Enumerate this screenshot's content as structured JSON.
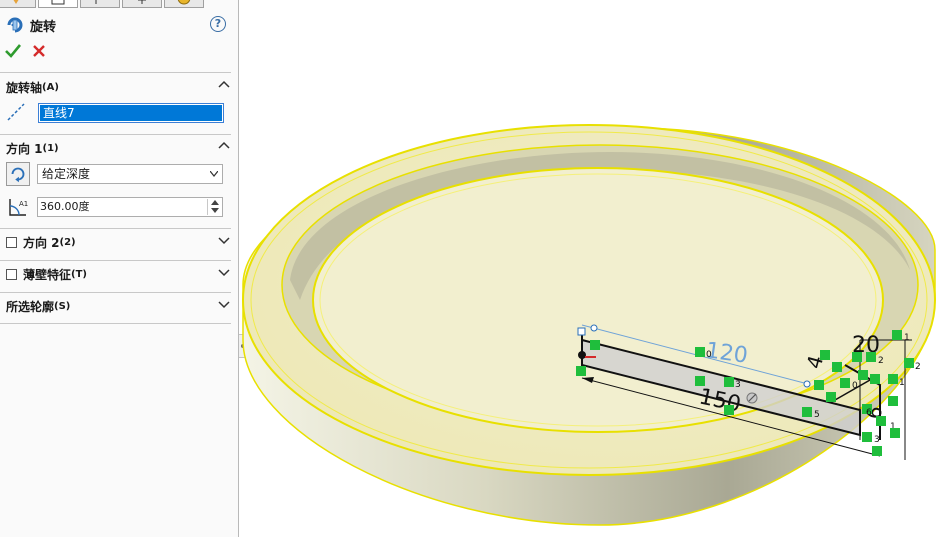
{
  "feature": {
    "title": "旋转",
    "help": "?"
  },
  "sections": {
    "axis": {
      "title": "旋转轴",
      "shortcut": "(A)",
      "value": "直线7"
    },
    "direction1": {
      "title": "方向 1",
      "shortcut": "(1)",
      "end_condition": "给定深度",
      "angle": "360.00度"
    },
    "direction2": {
      "title": "方向 2",
      "shortcut": "(2)",
      "checked": false
    },
    "thin_feature": {
      "title": "薄壁特征",
      "shortcut": "(T)",
      "checked": false
    },
    "selected_contours": {
      "title": "所选轮廓",
      "shortcut": "(S)"
    }
  },
  "sketch": {
    "dimensions": {
      "d120": "120",
      "d150": "150",
      "d20": "20",
      "d4": "4",
      "d6": "6"
    },
    "relation_numbers": [
      "0",
      "3",
      "2",
      "1",
      "0",
      "5",
      "6",
      "1",
      "2",
      "1",
      "3"
    ]
  },
  "colors": {
    "accent": "#0078d7",
    "ok": "#2e9b2e",
    "cancel": "#d42a2a",
    "preview_yellow": "#fbf7a8",
    "preview_edge": "#e8e000",
    "relation_green": "#1fbe3c"
  }
}
